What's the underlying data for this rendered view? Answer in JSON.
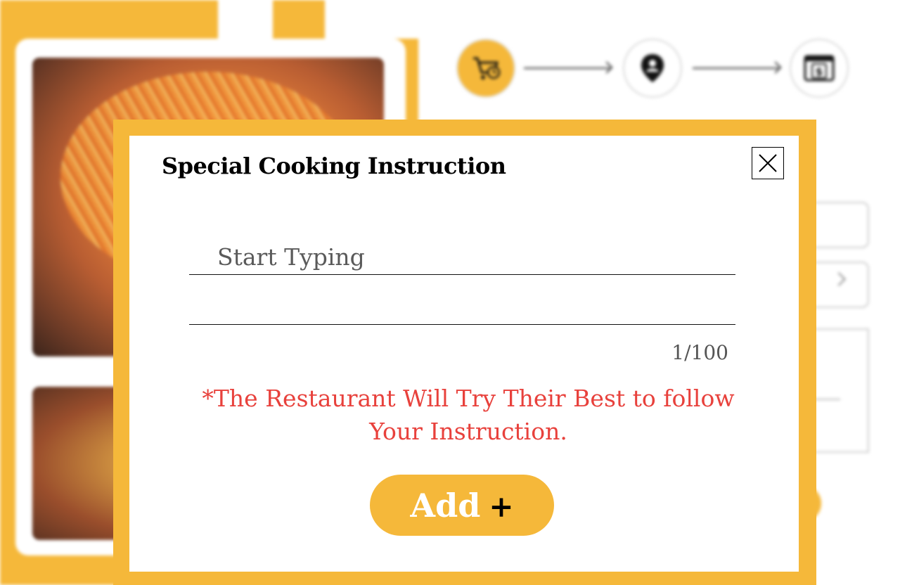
{
  "modal": {
    "title": "Special Cooking Instruction",
    "input_placeholder": "Start Typing",
    "input_value": "",
    "char_counter": "1/100",
    "notice_line1": "*The Restaurant Will Try Their Best to follow",
    "notice_line2": "Your Instruction.",
    "add_label": "Add",
    "add_icon": "+"
  },
  "colors": {
    "accent": "#f5b83a",
    "notice": "#e8413c"
  },
  "icons": {
    "close": "close-icon",
    "step1": "cart-clock-icon",
    "step2": "location-pin-icon",
    "step3": "payment-dollar-icon"
  }
}
